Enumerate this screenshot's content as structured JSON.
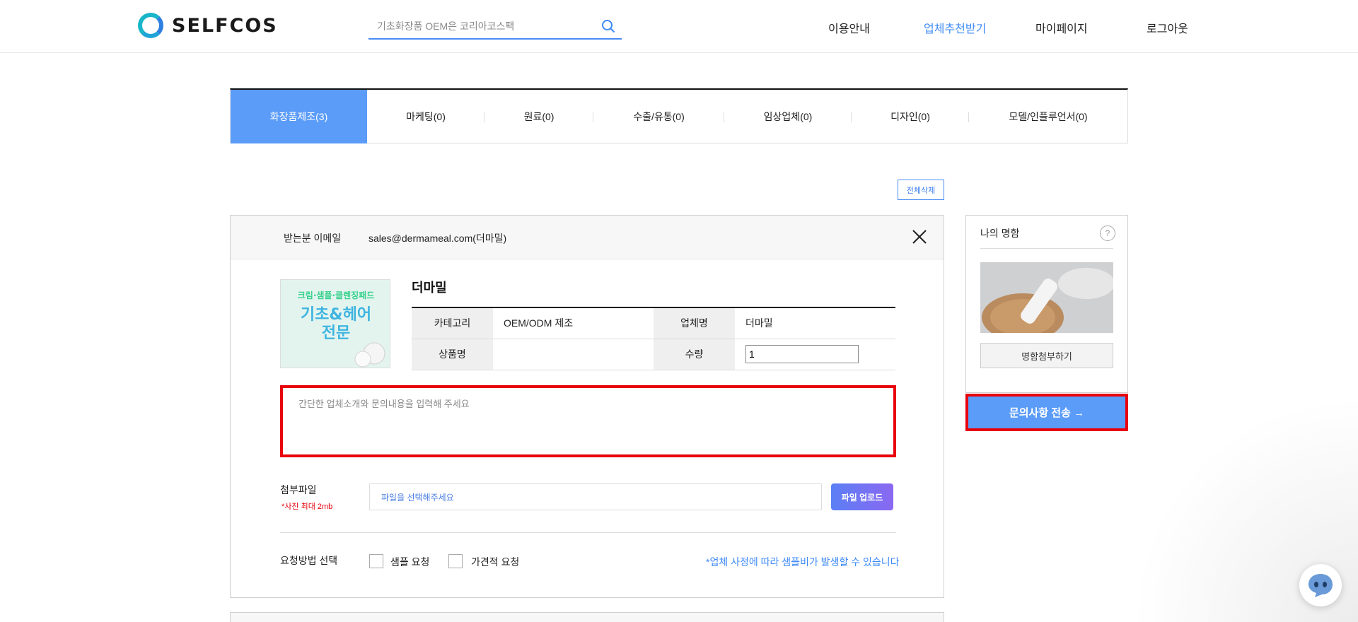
{
  "header": {
    "logo_text": "SELFCOS",
    "search_placeholder": "기초화장품 OEM은 코리아코스팩",
    "nav": [
      {
        "label": "이용안내",
        "active": false
      },
      {
        "label": "업체추천받기",
        "active": true
      },
      {
        "label": "마이페이지",
        "active": false
      },
      {
        "label": "로그아웃",
        "active": false
      }
    ]
  },
  "tabs": [
    {
      "label": "화장품제조(3)",
      "active": true
    },
    {
      "label": "마케팅(0)",
      "active": false
    },
    {
      "label": "원료(0)",
      "active": false
    },
    {
      "label": "수출/유통(0)",
      "active": false
    },
    {
      "label": "임상업체(0)",
      "active": false
    },
    {
      "label": "디자인(0)",
      "active": false
    },
    {
      "label": "모델/인플루언서(0)",
      "active": false
    }
  ],
  "delete_all_label": "전체삭제",
  "inquiry": {
    "recipient_label": "받는분 이메일",
    "recipient_email": "sales@dermameal.com(더마밀)",
    "company_title": "더마밀",
    "thumb_text_1": "크림·샘플·클렌징패드",
    "thumb_text_2": "기초&헤어",
    "thumb_text_3": "전문",
    "table": {
      "category_label": "카테고리",
      "category_value": "OEM/ODM 제조",
      "company_label": "업체명",
      "company_value": "더마밀",
      "product_label": "상품명",
      "product_value": "",
      "qty_label": "수량",
      "qty_value": "1"
    },
    "message_placeholder": "간단한 업체소개와 문의내용을 입력해 주세요",
    "attach_label": "첨부파일",
    "attach_note": "*사진 최대 2mb",
    "file_placeholder": "파일을 선택해주세요",
    "upload_label": "파일 업로드",
    "request_label": "요청방법 선택",
    "sample_request": "샘플 요청",
    "quote_request": "가견적 요청",
    "request_note": "*업체 사정에 따라 샘플비가 발생할 수 있습니다"
  },
  "business_card": {
    "title": "나의 명함",
    "help": "?",
    "attach_label": "명함첨부하기"
  },
  "send_label": "문의사항 전송 →",
  "colors": {
    "accent": "#5b9cf8",
    "highlight": "#e8000b",
    "nav_active": "#3d8af7"
  }
}
